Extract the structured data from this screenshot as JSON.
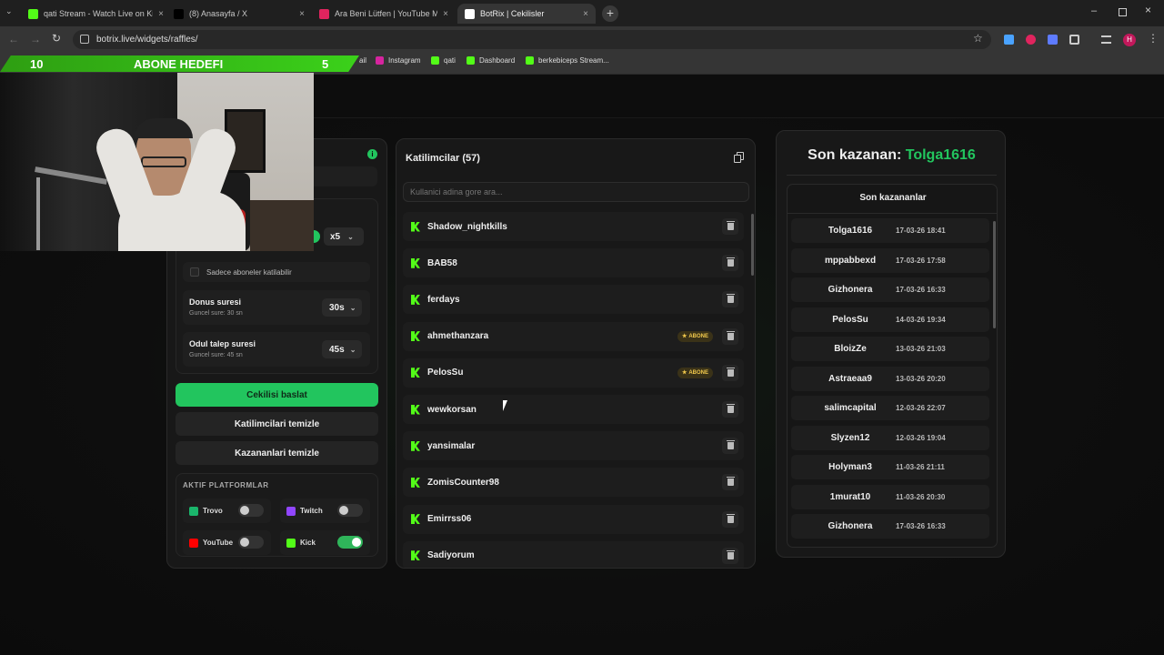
{
  "browser": {
    "tabs": [
      {
        "title": "qati Stream - Watch Live on Kick",
        "color": "#53fc18"
      },
      {
        "title": "(8) Anasayfa / X",
        "color": "#000000"
      },
      {
        "title": "Ara Beni Lütfen | YouTube M",
        "color": "#e0245e"
      },
      {
        "title": "BotRix | Cekilisler",
        "color": "#ffffff"
      }
    ],
    "url": "botrix.live/widgets/raffles/",
    "bookmarks": [
      "ail",
      "Instagram",
      "qati",
      "Dashboard",
      "berkebiceps Stream..."
    ]
  },
  "overlay": {
    "goal_current": "10",
    "goal_label": "ABONE HEDEFI",
    "goal_target": "5"
  },
  "settings": {
    "multiplier": "x5",
    "subs_only_label": "Sadece aboneler katilabilir",
    "donus": {
      "title": "Donus suresi",
      "sub": "Guncel sure: 30 sn",
      "value": "30s"
    },
    "odul": {
      "title": "Odul talep suresi",
      "sub": "Guncel sure: 45 sn",
      "value": "45s"
    },
    "start_button": "Cekilisi baslat",
    "clear_participants": "Katilimcilari temizle",
    "clear_winners": "Kazananlari temizle",
    "platforms_title": "AKTIF PLATFORMLAR",
    "platforms": [
      {
        "name": "Trovo",
        "enabled": false,
        "color": "#1ab56b"
      },
      {
        "name": "Twitch",
        "enabled": false,
        "color": "#9146ff"
      },
      {
        "name": "YouTube",
        "enabled": false,
        "color": "#ff0000"
      },
      {
        "name": "Kick",
        "enabled": true,
        "color": "#53fc18"
      }
    ]
  },
  "participants": {
    "title": "Katilimcilar (57)",
    "search_placeholder": "Kullanici adina gore ara...",
    "badge_label": "ABONE",
    "list": [
      {
        "name": "Shadow_nightkills",
        "abone": false
      },
      {
        "name": "BAB58",
        "abone": false
      },
      {
        "name": "ferdays",
        "abone": false
      },
      {
        "name": "ahmethanzara",
        "abone": true
      },
      {
        "name": "PelosSu",
        "abone": true
      },
      {
        "name": "wewkorsan",
        "abone": false
      },
      {
        "name": "yansimalar",
        "abone": false
      },
      {
        "name": "ZomisCounter98",
        "abone": false
      },
      {
        "name": "Emirrss06",
        "abone": false
      },
      {
        "name": "Sadiyorum",
        "abone": false
      }
    ]
  },
  "winners": {
    "last_label": "Son kazanan:",
    "last_name": "Tolga1616",
    "list_title": "Son kazananlar",
    "list": [
      {
        "name": "Tolga1616",
        "date": "17-03-26 18:41"
      },
      {
        "name": "mppabbexd",
        "date": "17-03-26 17:58"
      },
      {
        "name": "Gizhonera",
        "date": "17-03-26 16:33"
      },
      {
        "name": "PelosSu",
        "date": "14-03-26 19:34"
      },
      {
        "name": "BloizZe",
        "date": "13-03-26 21:03"
      },
      {
        "name": "Astraeaa9",
        "date": "13-03-26 20:20"
      },
      {
        "name": "salimcapital",
        "date": "12-03-26 22:07"
      },
      {
        "name": "Slyzen12",
        "date": "12-03-26 19:04"
      },
      {
        "name": "Holyman3",
        "date": "11-03-26 21:11"
      },
      {
        "name": "1murat10",
        "date": "11-03-26 20:30"
      },
      {
        "name": "Gizhonera",
        "date": "17-03-26 16:33"
      }
    ]
  },
  "colors": {
    "accent": "#22c55e",
    "kick": "#53fc18",
    "goal_bar": "#3bd11a"
  }
}
